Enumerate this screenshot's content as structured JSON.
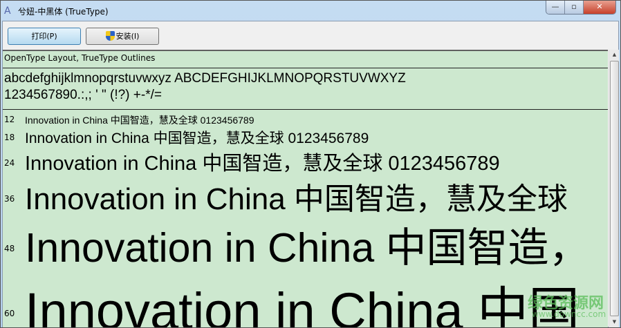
{
  "window": {
    "title": "兮妞-中黑体 (TrueType)",
    "minimize": "—",
    "maximize": "▫",
    "close": "✕"
  },
  "toolbar": {
    "print": "打印(P)",
    "install": "安装(I)"
  },
  "info": "OpenType Layout, TrueType Outlines",
  "charset": {
    "line1": "abcdefghijklmnopqrstuvwxyz ABCDEFGHIJKLMNOPQRSTUVWXYZ",
    "line2": "1234567890.:,; ' \" (!?) +-*/="
  },
  "samples": [
    {
      "size": "12",
      "text": "Innovation in China 中国智造，慧及全球 0123456789"
    },
    {
      "size": "18",
      "text": "Innovation in China 中国智造，慧及全球 0123456789"
    },
    {
      "size": "24",
      "text": "Innovation in China 中国智造，慧及全球 0123456789"
    },
    {
      "size": "36",
      "text": "Innovation in China 中国智造，慧及全球"
    },
    {
      "size": "48",
      "text": "Innovation in China 中国智造，"
    },
    {
      "size": "60",
      "text": "Innovation in China 中国"
    }
  ],
  "watermark": {
    "name": "绿色资源网",
    "url": "www.downcc.com"
  }
}
